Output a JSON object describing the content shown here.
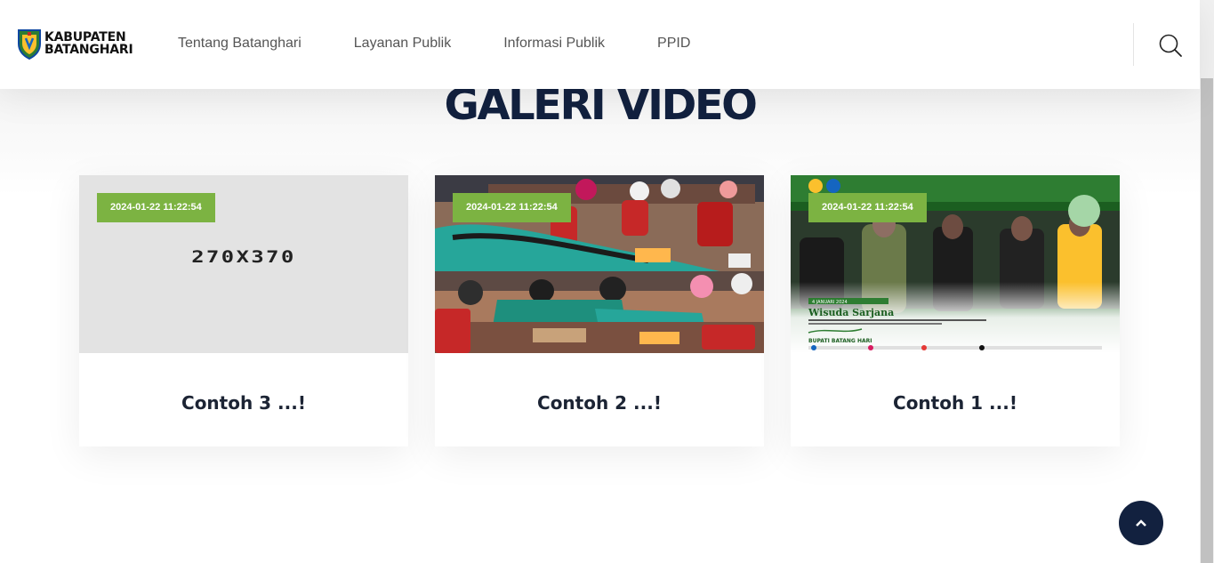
{
  "brand": {
    "line1": "KABUPATEN",
    "line2": "BATANGHARI"
  },
  "nav": {
    "items": [
      {
        "label": "Tentang Batanghari"
      },
      {
        "label": "Layanan Publik"
      },
      {
        "label": "Informasi Publik"
      },
      {
        "label": "PPID"
      }
    ]
  },
  "section": {
    "title": "GALERI VIDEO"
  },
  "cards": [
    {
      "date": "2024-01-22 11:22:54",
      "title": "Contoh 3 ...!",
      "image_text": "270X370"
    },
    {
      "date": "2024-01-22 11:22:54",
      "title": "Contoh 2 ...!"
    },
    {
      "date": "2024-01-22 11:22:54",
      "title": "Contoh 1 ...!"
    }
  ],
  "card3_image": {
    "headline": "Wisuda Sarjana",
    "date_tag": "4 JANUARI 2024",
    "footer": "BUPATI BATANG HARI"
  },
  "icons": {
    "search": "search-icon",
    "back_to_top": "chevron-up-icon"
  },
  "colors": {
    "accent_green": "#7cb342",
    "navy": "#12213f"
  }
}
